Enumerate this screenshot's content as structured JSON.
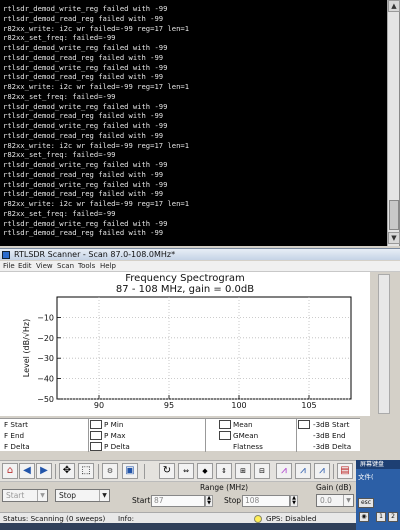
{
  "console": {
    "lines": [
      "rtlsdr_demod_write_reg failed with -99",
      "rtlsdr_demod_read_reg failed with -99",
      "r82xx_write: i2c wr failed=-99 reg=17 len=1",
      "r82xx_set_freq: failed=-99",
      "rtlsdr_demod_write_reg failed with -99",
      "rtlsdr_demod_read_reg failed with -99",
      "rtlsdr_demod_write_reg failed with -99",
      "rtlsdr_demod_read_reg failed with -99",
      "r82xx_write: i2c wr failed=-99 reg=17 len=1",
      "r82xx_set_freq: failed=-99",
      "rtlsdr_demod_write_reg failed with -99",
      "rtlsdr_demod_read_reg failed with -99",
      "rtlsdr_demod_write_reg failed with -99",
      "rtlsdr_demod_read_reg failed with -99",
      "r82xx_write: i2c wr failed=-99 reg=17 len=1",
      "r82xx_set_freq: failed=-99",
      "rtlsdr_demod_write_reg failed with -99",
      "rtlsdr_demod_read_reg failed with -99",
      "rtlsdr_demod_write_reg failed with -99",
      "rtlsdr_demod_read_reg failed with -99",
      "r82xx_write: i2c wr failed=-99 reg=17 len=1",
      "r82xx_set_freq: failed=-99",
      "rtlsdr_demod_write_reg failed with -99",
      "rtlsdr_demod_read_reg failed with -99"
    ]
  },
  "window": {
    "title": "RTLSDR Scanner - Scan 87.0-108.0MHz*"
  },
  "menu": {
    "file": "File",
    "edit": "Edit",
    "view": "View",
    "scan": "Scan",
    "tools": "Tools",
    "help": "Help"
  },
  "chart_data": {
    "type": "line",
    "title": "Frequency Spectrogram",
    "subtitle": "87 - 108 MHz, gain = 0.0dB",
    "ylabel": "Level (dB/√Hz)",
    "xlabel": "",
    "x_ticks": [
      90,
      95,
      100,
      105
    ],
    "y_ticks": [
      -10,
      -20,
      -30,
      -40,
      -50
    ],
    "xlim": [
      87,
      108
    ],
    "ylim": [
      -50,
      0
    ],
    "grid": true,
    "series": []
  },
  "stats": {
    "f_start": "F Start",
    "f_end": "F End",
    "f_delta": "F Delta",
    "p_min": "P Min",
    "p_max": "P Max",
    "p_delta": "P Delta",
    "mean": "Mean",
    "gmean": "GMean",
    "flatness": "Flatness",
    "db3_start": "-3dB Start",
    "db3_end": "-3dB End",
    "db3_delta": "-3dB Delta"
  },
  "controls": {
    "start_button": "Start",
    "stop_button": "Stop",
    "range_label": "Range (MHz)",
    "start_label": "Start",
    "start_value": "87",
    "stop_label": "Stop",
    "stop_value": "108",
    "gain_label": "Gain (dB)",
    "gain_value": "0.0"
  },
  "status": {
    "status_text": "Status: Scanning (0 sweeps)",
    "info_text": "Info:",
    "gps_text": "GPS: Disabled"
  },
  "ime": {
    "title": "屏幕键盘",
    "label": "文件(",
    "esc": "esc",
    "key1": "1",
    "key2": "2"
  }
}
